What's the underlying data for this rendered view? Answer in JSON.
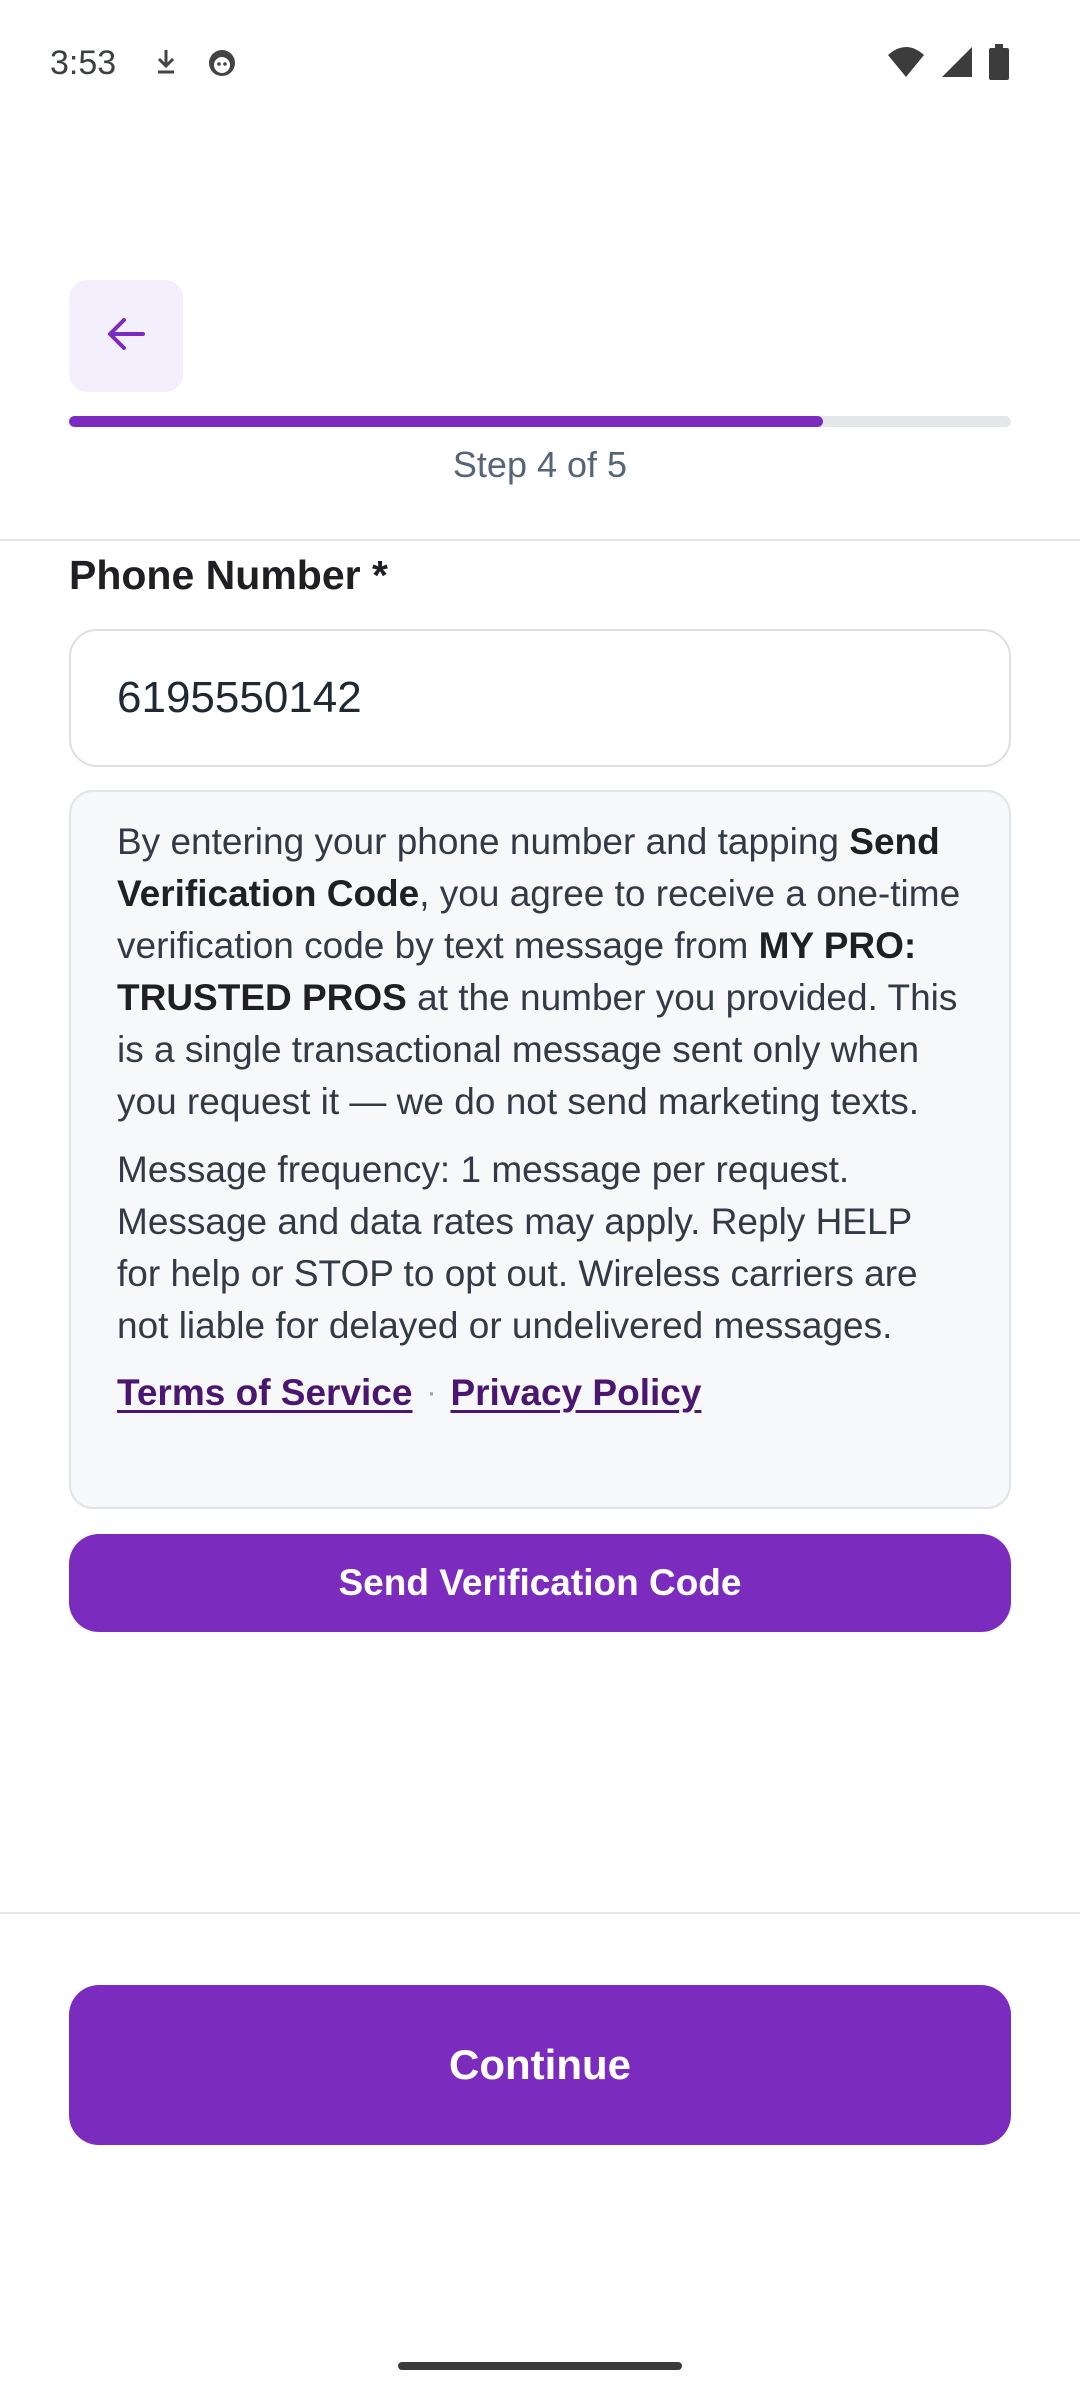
{
  "status_bar": {
    "time": "3:53",
    "left_icons": [
      "download-arrow-icon",
      "face-icon"
    ],
    "right_icons": [
      "wifi-icon",
      "signal-icon",
      "battery-icon"
    ]
  },
  "header": {
    "back_icon": "arrow-left-icon",
    "progress_fraction": 0.8,
    "step_label": "Step 4 of 5"
  },
  "form": {
    "phone_label": "Phone Number *",
    "phone_value": "6195550142"
  },
  "consent": {
    "p1_a": "By entering your phone number and tapping ",
    "p1_b_bold": "Send Verification Code",
    "p1_c": ", you agree to receive a one-time verification code by text message from ",
    "p1_d_bold": "MY PRO: TRUSTED PROS",
    "p1_e": " at the number you provided. This is a single transactional message sent only when you request it — we do not send marketing texts.",
    "p2": "Message frequency: 1 message per request. Message and data rates may apply. Reply HELP for help or STOP to opt out. Wireless carriers are not liable for delayed or undelivered messages.",
    "terms_link": "Terms of Service",
    "separator": "·",
    "privacy_link": "Privacy Policy"
  },
  "buttons": {
    "send_code": "Send Verification Code",
    "continue": "Continue"
  },
  "colors": {
    "accent": "#7b2cbf",
    "back_button_bg": "#f4effd",
    "link": "#4a1670"
  }
}
